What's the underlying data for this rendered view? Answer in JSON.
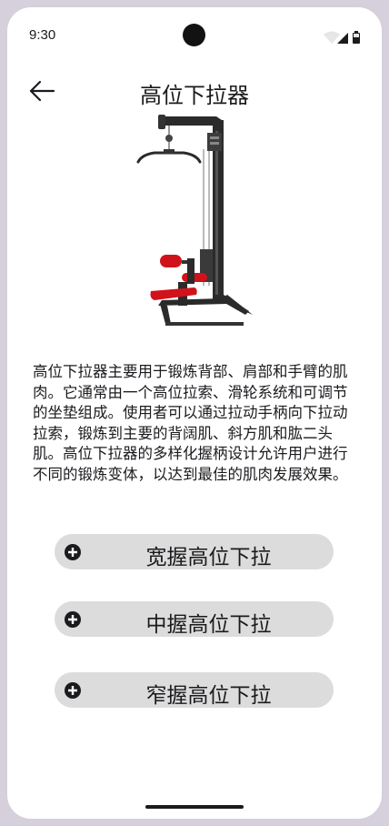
{
  "status_bar": {
    "time": "9:30",
    "icons": [
      "wifi-icon",
      "cellular-icon",
      "battery-icon"
    ]
  },
  "app_bar": {
    "back_icon": "arrow-left-icon",
    "title": "高位下拉器"
  },
  "image": {
    "subject": "lat-pulldown-machine"
  },
  "description": "高位下拉器主要用于锻炼背部、肩部和手臂的肌肉。它通常由一个高位拉索、滑轮系统和可调节的坐垫组成。使用者可以通过拉动手柄向下拉动拉索，锻炼到主要的背阔肌、斜方肌和肱二头肌。高位下拉器的多样化握柄设计允许用户进行不同的锻炼变体，以达到最佳的肌肉发展效果。",
  "grip_options": [
    {
      "label": "宽握高位下拉",
      "icon": "plus-circle-icon"
    },
    {
      "label": "中握高位下拉",
      "icon": "plus-circle-icon"
    },
    {
      "label": "窄握高位下拉",
      "icon": "plus-circle-icon"
    }
  ],
  "colors": {
    "background": "#ffffff",
    "frame": "#d6cfdc",
    "button": "#dcdcdc",
    "text": "#1b1b1f",
    "seat": "#d0121b"
  }
}
